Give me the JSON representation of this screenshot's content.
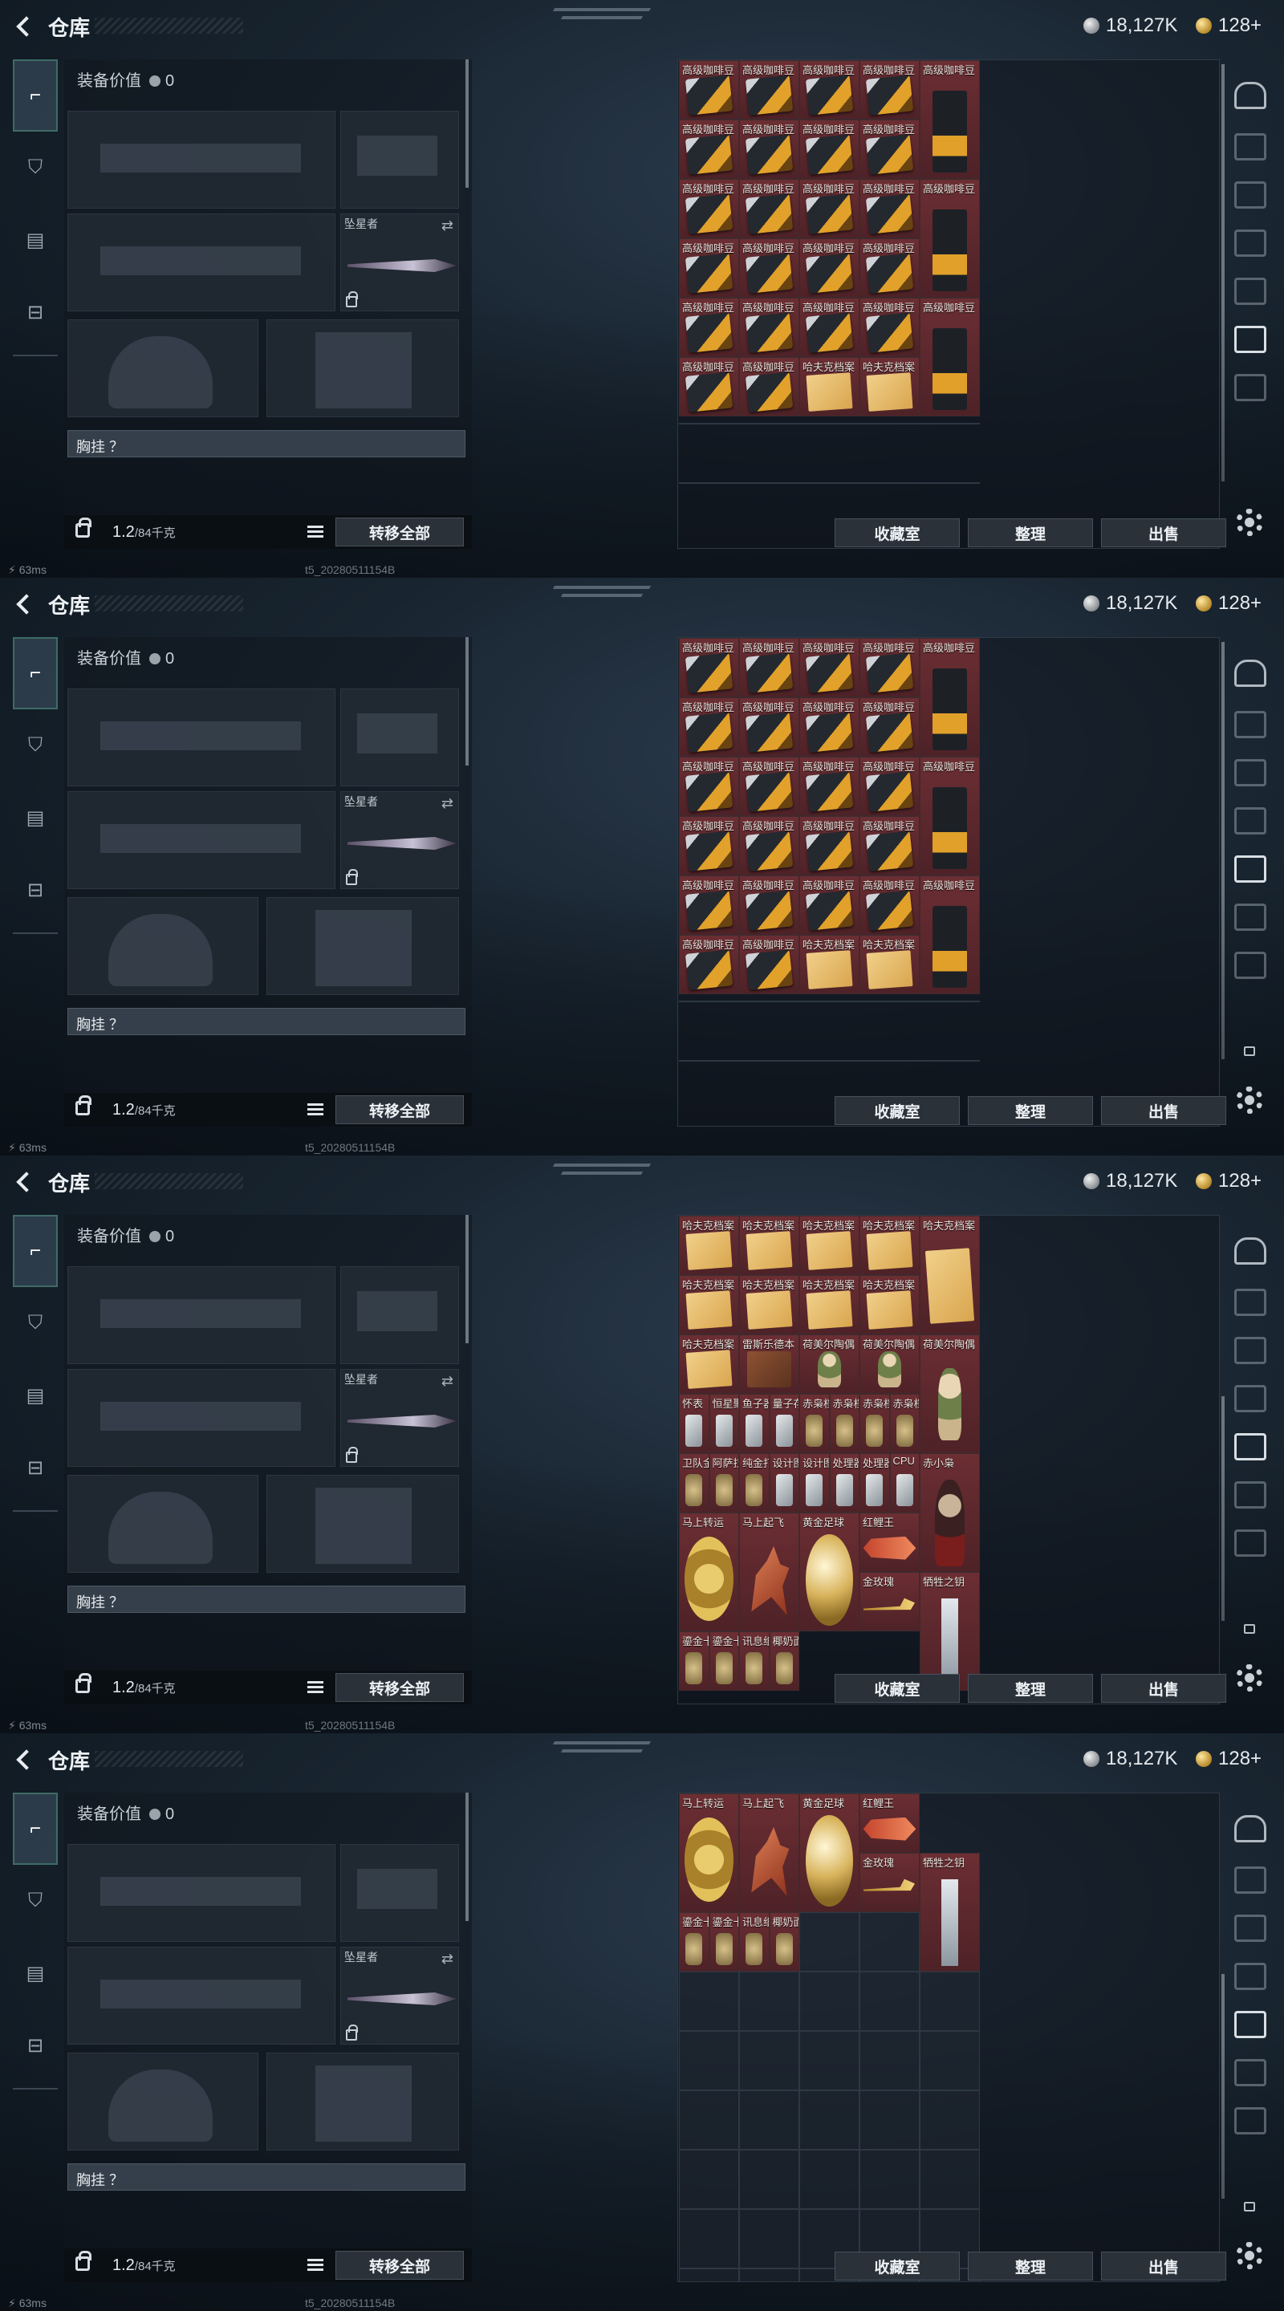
{
  "header": {
    "title": "仓库",
    "currency_silver": "18,127K",
    "currency_gold": "128+"
  },
  "loadout": {
    "value_label": "装备价值",
    "value": "0",
    "knife_label": "坠星者",
    "chest_label": "胸挂 ？",
    "weight_current": "1.2",
    "weight_max": "/84千克",
    "transfer_all": "转移全部"
  },
  "actions": {
    "collection": "收藏室",
    "sort": "整理",
    "sell": "出售"
  },
  "status": {
    "ping": "63ms",
    "build": "t5_20280511154B"
  },
  "screen1_rows": [
    [
      "高级咖啡豆",
      "高级咖啡豆",
      "高级咖啡豆",
      "高级咖啡豆",
      "高级咖啡豆"
    ],
    [
      "高级咖啡豆",
      "高级咖啡豆",
      "高级咖啡豆",
      "高级咖啡豆",
      ""
    ],
    [
      "高级咖啡豆",
      "高级咖啡豆",
      "高级咖啡豆",
      "高级咖啡豆",
      "高级咖啡豆"
    ],
    [
      "高级咖啡豆",
      "高级咖啡豆",
      "高级咖啡豆",
      "高级咖啡豆",
      ""
    ],
    [
      "高级咖啡豆",
      "高级咖啡豆",
      "高级咖啡豆",
      "高级咖啡豆",
      "高级咖啡豆"
    ],
    [
      "高级咖啡豆",
      "高级咖啡豆",
      "哈夫克档案",
      "哈夫克档案",
      ""
    ]
  ],
  "screen3": {
    "docs": [
      "哈夫克档案",
      "哈夫克档案",
      "哈夫克档案",
      "哈夫克档案",
      "哈夫克档案"
    ],
    "docs2": [
      "哈夫克档案",
      "哈夫克档案",
      "哈夫克档案",
      "哈夫克档案"
    ],
    "row3": [
      "哈夫克档案",
      "雷斯乐德本",
      "荷美尔陶偶",
      "荷美尔陶偶",
      "荷美尔陶偶"
    ],
    "small_row1": [
      "怀表",
      "恒星聚感器",
      "鱼子器",
      "量子存储",
      "赤枭档案",
      "赤枭档案",
      "赤枭档案",
      "赤枭档案"
    ],
    "small_row2": [
      "卫队金戒指",
      "阿萨拉酒杯",
      "纯金打火机",
      "设计图纸",
      "设计图纸",
      "处理器",
      "处理器",
      "CPU",
      "赤小枭"
    ],
    "big": [
      "马上转运",
      "马上起飞",
      "黄金足球",
      "红鲤王",
      "金玫瑰",
      "牺牲之钥"
    ],
    "bottom": [
      "鎏金卡牌",
      "鎏金卡牌",
      "讯息纸条",
      "椰奶面包浆"
    ]
  }
}
